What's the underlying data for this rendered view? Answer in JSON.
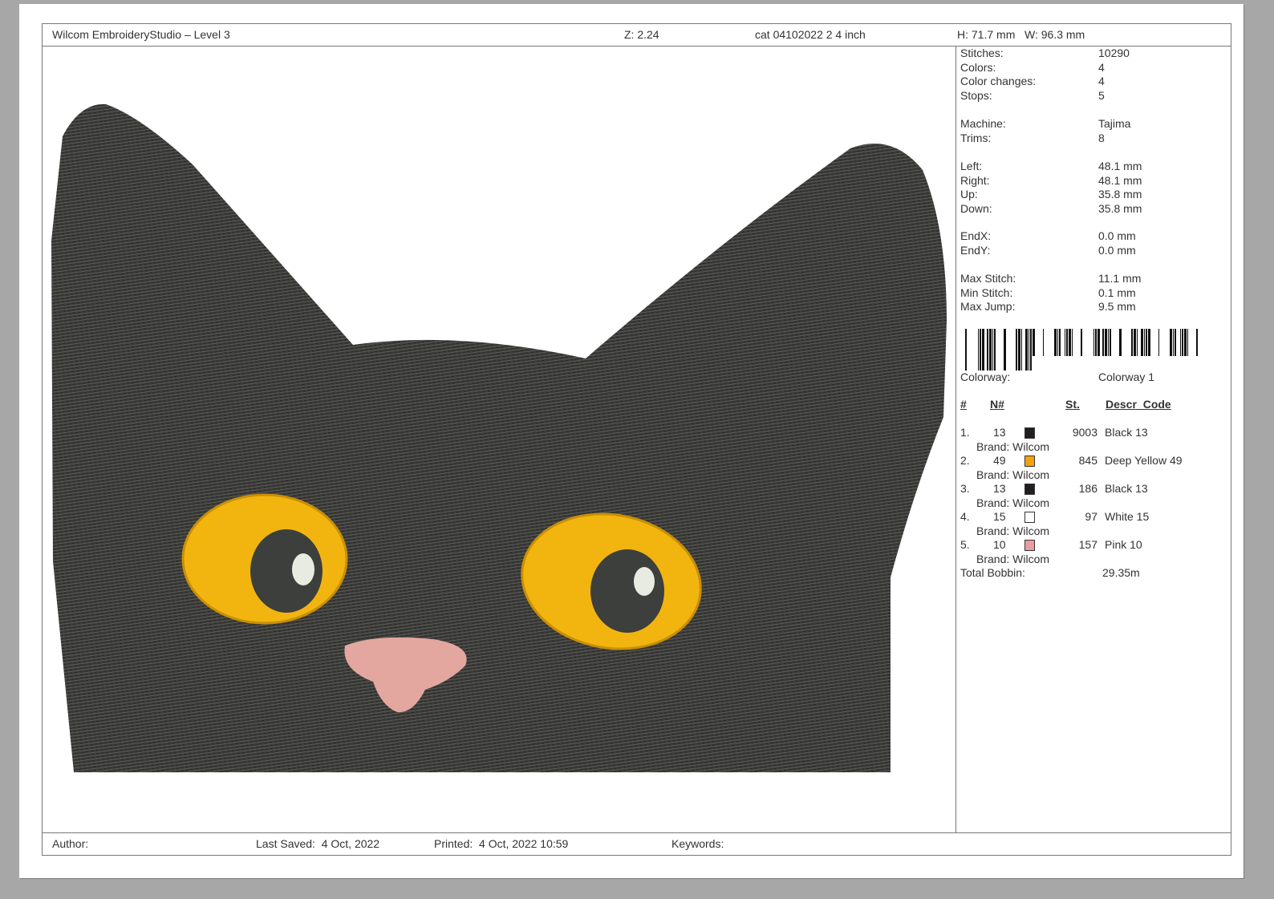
{
  "header": {
    "app": "Wilcom EmbroideryStudio – Level 3",
    "zoom": "Z: 2.24",
    "design": "cat 04102022 2 4 inch",
    "size": "H: 71.7 mm   W: 96.3 mm"
  },
  "stats": [
    {
      "label": "Stitches:",
      "value": "10290"
    },
    {
      "label": "Colors:",
      "value": "4"
    },
    {
      "label": "Color changes:",
      "value": "4"
    },
    {
      "label": "Stops:",
      "value": "5"
    },
    {
      "label": "Machine:",
      "value": "Tajima"
    },
    {
      "label": "Trims:",
      "value": "8"
    },
    {
      "label": "Left:",
      "value": "48.1 mm"
    },
    {
      "label": "Right:",
      "value": "48.1 mm"
    },
    {
      "label": "Up:",
      "value": "35.8 mm"
    },
    {
      "label": "Down:",
      "value": "35.8 mm"
    },
    {
      "label": "EndX:",
      "value": "0.0 mm"
    },
    {
      "label": "EndY:",
      "value": "0.0 mm"
    },
    {
      "label": "Max Stitch:",
      "value": "11.1 mm"
    },
    {
      "label": "Min Stitch:",
      "value": "0.1 mm"
    },
    {
      "label": "Max Jump:",
      "value": "9.5 mm"
    }
  ],
  "colorway": {
    "label": "Colorway:",
    "value": "Colorway 1"
  },
  "table": {
    "headers": [
      "#",
      "N#",
      "St.",
      "Descr_Code"
    ],
    "rows": [
      {
        "num": "1.",
        "n": "13",
        "color": "#231f20",
        "st": "9003",
        "descr": "Black 13",
        "brand": "Brand: Wilcom"
      },
      {
        "num": "2.",
        "n": "49",
        "color": "#f5a20f",
        "st": "845",
        "descr": "Deep Yellow 49",
        "brand": "Brand: Wilcom"
      },
      {
        "num": "3.",
        "n": "13",
        "color": "#231f20",
        "st": "186",
        "descr": "Black 13",
        "brand": "Brand: Wilcom"
      },
      {
        "num": "4.",
        "n": "15",
        "color": "#ffffff",
        "st": "97",
        "descr": "White 15",
        "brand": "Brand: Wilcom"
      },
      {
        "num": "5.",
        "n": "10",
        "color": "#eb9ca0",
        "st": "157",
        "descr": "Pink 10",
        "brand": "Brand: Wilcom"
      }
    ]
  },
  "bobbin": {
    "label": "Total Bobbin:",
    "value": "29.35m"
  },
  "footer": {
    "author": "Author:",
    "saved": "Last Saved:  4 Oct, 2022",
    "printed": "Printed:  4 Oct, 2022 10:59",
    "keywords": "Keywords:"
  }
}
